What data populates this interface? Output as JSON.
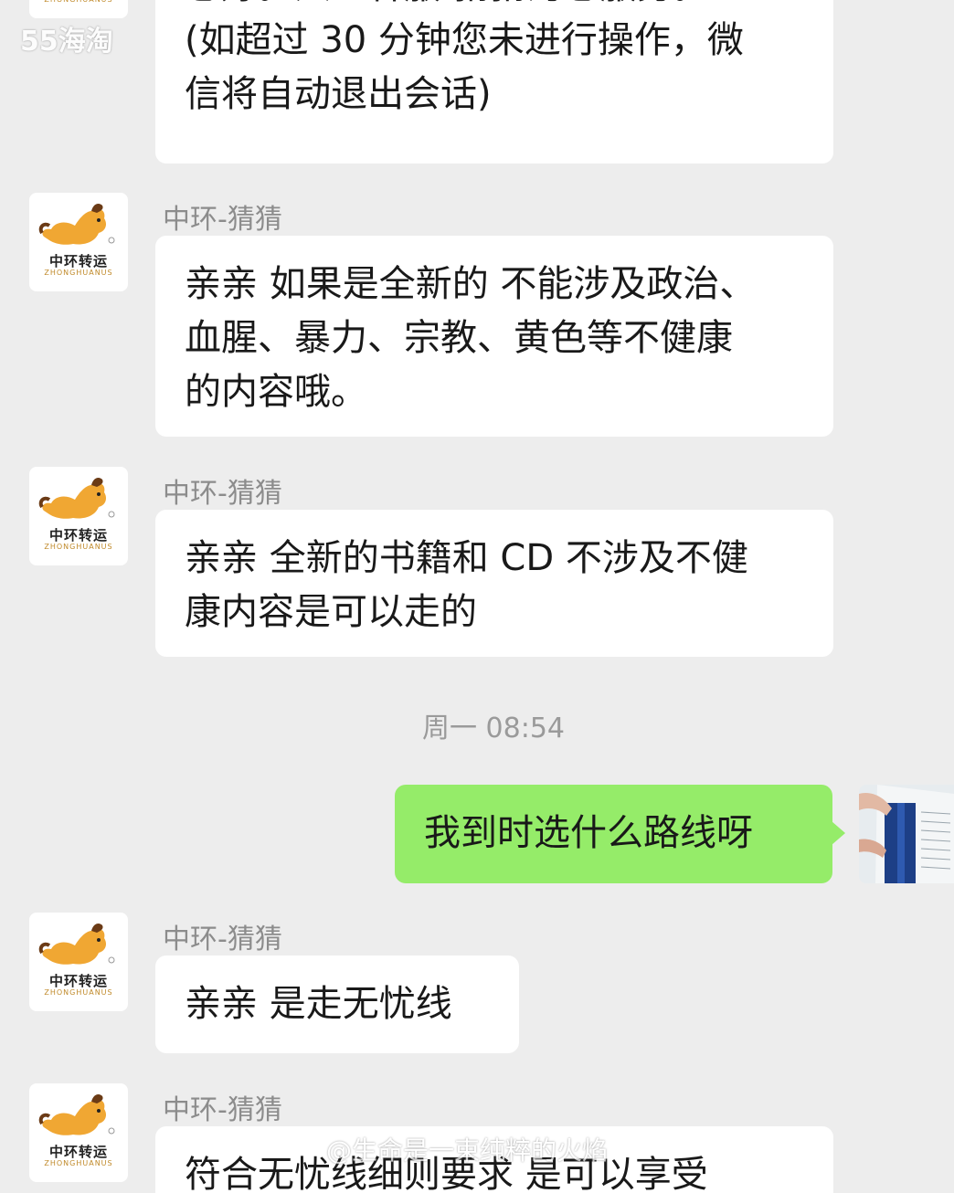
{
  "watermarks": {
    "top": "55海淘",
    "bottom": "@生命是一束纯粹的火焰"
  },
  "agent": {
    "name": "中环-猜猜",
    "logo_cn": "中环转运",
    "logo_en": "ZHONGHUANUS"
  },
  "messages": {
    "m0_lines": [
      "您好。人工客服-猜猜为您服务。",
      "(如超过 30 分钟您未进行操作，微",
      "信将自动退出会话)"
    ],
    "m1_lines": [
      "亲亲 如果是全新的 不能涉及政治、",
      "血腥、暴力、宗教、黄色等不健康",
      "的内容哦。"
    ],
    "m2_lines": [
      "亲亲 全新的书籍和 CD 不涉及不健",
      "康内容是可以走的"
    ],
    "timestamp": "周一 08:54",
    "m3_user": "我到时选什么路线呀",
    "m4": "亲亲 是走无忧线",
    "m5_partial": "符合无忧线细则要求 是可以享受"
  },
  "colors": {
    "background": "#ededed",
    "incoming_bubble": "#ffffff",
    "outgoing_bubble": "#95ec69"
  }
}
